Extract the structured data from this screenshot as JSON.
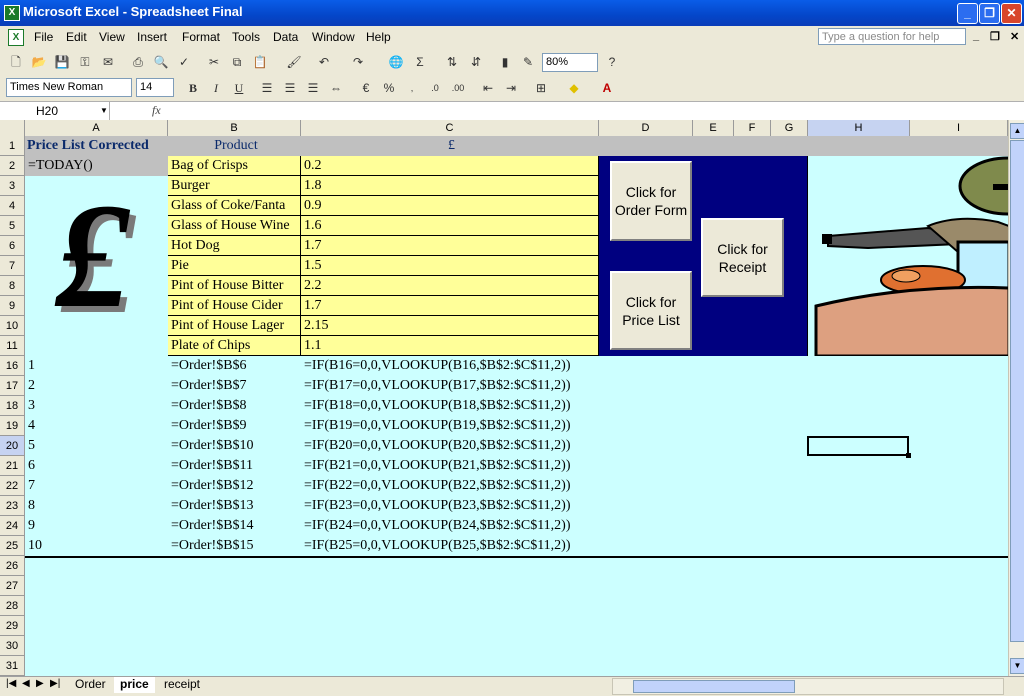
{
  "window": {
    "title": "Microsoft Excel - Spreadsheet Final"
  },
  "menu": {
    "items": [
      "File",
      "Edit",
      "View",
      "Insert",
      "Format",
      "Tools",
      "Data",
      "Window",
      "Help"
    ],
    "ask_placeholder": "Type a question for help"
  },
  "toolbar": {
    "zoom": "80%",
    "font_name": "Times New Roman",
    "font_size": "14"
  },
  "formula_bar": {
    "cell_ref": "H20",
    "fx_label": "fx",
    "content": ""
  },
  "grid": {
    "columns": [
      "A",
      "B",
      "C",
      "D",
      "E",
      "F",
      "G",
      "H",
      "I"
    ],
    "selected_column": "H",
    "rows": [
      "1",
      "2",
      "3",
      "4",
      "5",
      "6",
      "7",
      "8",
      "9",
      "10",
      "11",
      "16",
      "17",
      "18",
      "19",
      "20",
      "21",
      "22",
      "23",
      "24",
      "25",
      "26",
      "27",
      "28",
      "29",
      "30",
      "31"
    ],
    "selected_row": "20",
    "header_row": {
      "a": "Price List Corrected",
      "b": "Product",
      "c": "£"
    },
    "a2": "=TODAY()",
    "price_rows": [
      {
        "product": "Bag of Crisps",
        "price": "0.2"
      },
      {
        "product": "Burger",
        "price": "1.8"
      },
      {
        "product": "Glass of Coke/Fanta",
        "price": "0.9"
      },
      {
        "product": "Glass of House Wine",
        "price": "1.6"
      },
      {
        "product": "Hot Dog",
        "price": "1.7"
      },
      {
        "product": "Pie",
        "price": "1.5"
      },
      {
        "product": "Pint of House Bitter",
        "price": "2.2"
      },
      {
        "product": "Pint of House Cider",
        "price": "1.7"
      },
      {
        "product": "Pint of House Lager",
        "price": "2.15"
      },
      {
        "product": "Plate of Chips",
        "price": "1.1"
      }
    ],
    "formula_rows": [
      {
        "a": "1",
        "b": "=Order!$B$6",
        "c": "=IF(B16=0,0,VLOOKUP(B16,$B$2:$C$11,2))"
      },
      {
        "a": "2",
        "b": "=Order!$B$7",
        "c": "=IF(B17=0,0,VLOOKUP(B17,$B$2:$C$11,2))"
      },
      {
        "a": "3",
        "b": "=Order!$B$8",
        "c": "=IF(B18=0,0,VLOOKUP(B18,$B$2:$C$11,2))"
      },
      {
        "a": "4",
        "b": "=Order!$B$9",
        "c": "=IF(B19=0,0,VLOOKUP(B19,$B$2:$C$11,2))"
      },
      {
        "a": "5",
        "b": "=Order!$B$10",
        "c": "=IF(B20=0,0,VLOOKUP(B20,$B$2:$C$11,2))"
      },
      {
        "a": "6",
        "b": "=Order!$B$11",
        "c": "=IF(B21=0,0,VLOOKUP(B21,$B$2:$C$11,2))"
      },
      {
        "a": "7",
        "b": "=Order!$B$12",
        "c": "=IF(B22=0,0,VLOOKUP(B22,$B$2:$C$11,2))"
      },
      {
        "a": "8",
        "b": "=Order!$B$13",
        "c": "=IF(B23=0,0,VLOOKUP(B23,$B$2:$C$11,2))"
      },
      {
        "a": "9",
        "b": "=Order!$B$14",
        "c": "=IF(B24=0,0,VLOOKUP(B24,$B$2:$C$11,2))"
      },
      {
        "a": "10",
        "b": "=Order!$B$15",
        "c": "=IF(B25=0,0,VLOOKUP(B25,$B$2:$C$11,2))"
      }
    ]
  },
  "buttons": {
    "order_form": [
      "Click for",
      "Order Form"
    ],
    "receipt": [
      "Click for",
      "Receipt"
    ],
    "price_list": [
      "Click for",
      "Price List"
    ]
  },
  "sheet_tabs": [
    "Order",
    "price",
    "receipt"
  ],
  "active_tab": "price",
  "colors": {
    "cell_fill": "#ccffff",
    "price_fill": "#ffff99",
    "panel": "#000080",
    "selection": "#c6d3f1"
  }
}
